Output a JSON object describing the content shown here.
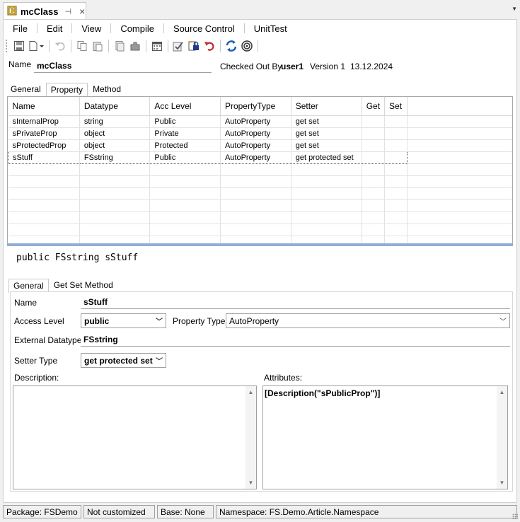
{
  "window": {
    "doc_tab_title": "mcClass",
    "pin_glyph": "⊣",
    "close_glyph": "×"
  },
  "menu": {
    "items": [
      "File",
      "Edit",
      "View",
      "Compile",
      "Source Control",
      "UnitTest"
    ]
  },
  "toolbar": {
    "icons": [
      "save-icon",
      "new-document-icon",
      "undo-icon",
      "copy-icon",
      "paste-icon",
      "duplicate-icon",
      "plugin-icon",
      "calendar-icon",
      "checkout-icon",
      "lock-icon",
      "revert-icon",
      "refresh-icon",
      "target-icon"
    ]
  },
  "header": {
    "name_label": "Name",
    "name_value": "mcClass",
    "checked_out_label": "Checked Out By",
    "checked_out_user": "user1",
    "version": "Version 1",
    "date": "13.12.2024"
  },
  "top_tabs": [
    {
      "label": "General",
      "active": false
    },
    {
      "label": "Property",
      "active": true
    },
    {
      "label": "Method",
      "active": false
    }
  ],
  "grid": {
    "columns": [
      "Name",
      "Datatype",
      "Acc Level",
      "PropertyType",
      "Setter",
      "Get",
      "Set"
    ],
    "rows": [
      [
        "sInternalProp",
        "string",
        "Public",
        "AutoProperty",
        "get set",
        "",
        ""
      ],
      [
        "sPrivateProp",
        "object",
        "Private",
        "AutoProperty",
        "get set",
        "",
        ""
      ],
      [
        "sProtectedProp",
        "object",
        "Protected",
        "AutoProperty",
        "get set",
        "",
        ""
      ],
      [
        "sStuff",
        "FSstring",
        "Public",
        "AutoProperty",
        "get protected set",
        "",
        ""
      ]
    ],
    "selected_row": 3
  },
  "signature": "public FSstring sStuff",
  "detail_tabs": [
    {
      "label": "General",
      "active": true
    },
    {
      "label": "Get Set Method",
      "active": false
    }
  ],
  "detail": {
    "name_label": "Name",
    "name_value": "sStuff",
    "access_level_label": "Access Level",
    "access_level_value": "public",
    "property_type_label": "Property Type",
    "property_type_value": "AutoProperty",
    "external_datatype_label": "External Datatype",
    "external_datatype_value": "FSstring",
    "setter_type_label": "Setter Type",
    "setter_type_value": "get protected set",
    "description_label": "Description:",
    "description_value": "",
    "attributes_label": "Attributes:",
    "attributes_value": "[Description(\"sPublicProp\")]"
  },
  "status": {
    "package": "Package: FSDemo",
    "customized": "Not customized",
    "base": "Base: None",
    "namespace": "Namespace: FS.Demo.Article.Namespace"
  },
  "colors": {
    "accent": "#8fb0d4",
    "revert": "#c0282d",
    "refresh": "#1e5fb4"
  }
}
